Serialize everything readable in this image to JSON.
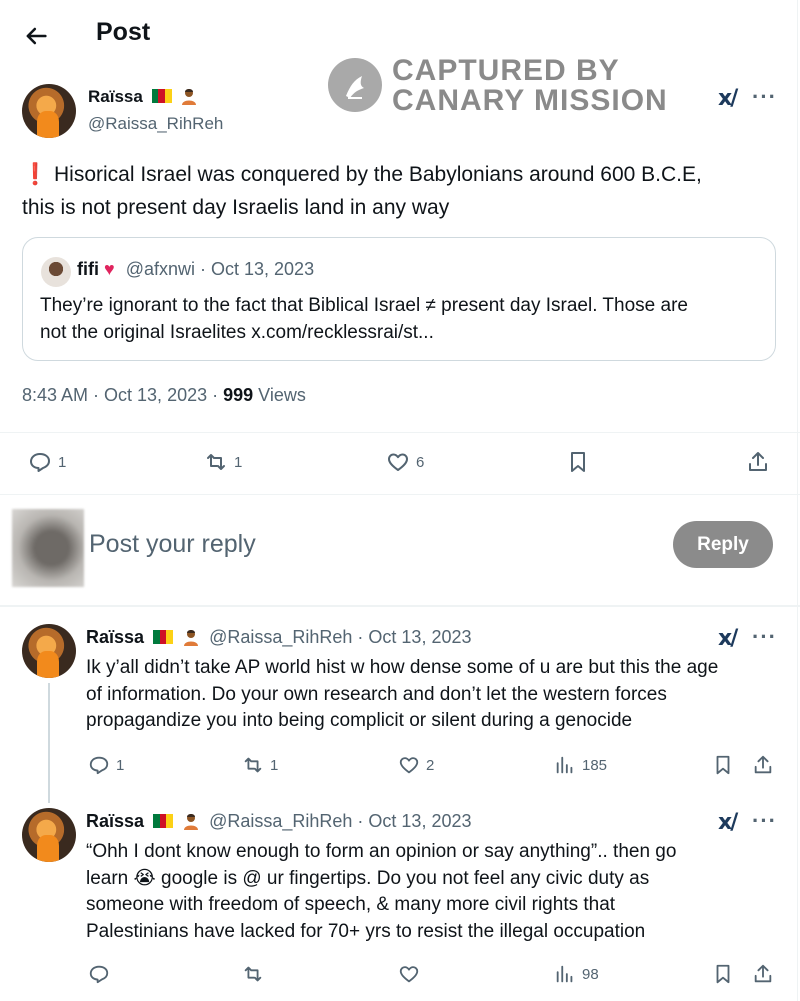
{
  "header": {
    "title": "Post"
  },
  "watermark": {
    "line1": "CAPTURED BY",
    "line2": "CANARY MISSION"
  },
  "main_post": {
    "author_name": "Raïssa",
    "handle": "@Raissa_RihReh",
    "exclamation": "❗",
    "text_line1": "Hisorical Israel was conquered by the Babylonians around 600 B.C.E,",
    "text_line2": "this is not present day Israelis land in any way",
    "quote": {
      "name": "fifi",
      "handle_date": "@afxnwi · Oct 13, 2023",
      "text_line1": "They’re ignorant to the fact that Biblical Israel ≠ present day Israel. Those are",
      "text_line2": "not the original Israelites x.com/recklessrai/st..."
    },
    "timestamp": "8:43 AM · Oct 13, 2023 · ",
    "views_count": "999",
    "views_label": " Views",
    "reply_count": "1",
    "repost_count": "1",
    "like_count": "6"
  },
  "composer": {
    "placeholder": "Post your reply",
    "reply_button": "Reply"
  },
  "replies": [
    {
      "author_name": "Raïssa",
      "handle_date": "@Raissa_RihReh · Oct 13, 2023",
      "lines": [
        "Ik y’all didn’t take AP world hist w how dense some of u are but this the age",
        "of information. Do your own research and don’t let the western forces",
        "propagandize you into being complicit or silent during a genocide"
      ],
      "reply_count": "1",
      "repost_count": "1",
      "like_count": "2",
      "views": "185"
    },
    {
      "author_name": "Raïssa",
      "handle_date": "@Raissa_RihReh · Oct 13, 2023",
      "lines": [
        "“Ohh I dont know enough to form an opinion or say anything”.. then go",
        "learn 😭 google is @ ur fingertips. Do you not feel any civic duty as",
        "someone with freedom of speech, & many more civil rights that",
        "Palestinians have lacked for 70+ yrs to resist the illegal occupation"
      ],
      "views": "98"
    }
  ],
  "colors": {
    "accent": "#1d9bf0",
    "muted": "#536471",
    "reply_button_bg": "#8b8b8b",
    "flag_green": "#007a3d",
    "flag_red": "#ce1126",
    "flag_yellow": "#fcd116"
  }
}
